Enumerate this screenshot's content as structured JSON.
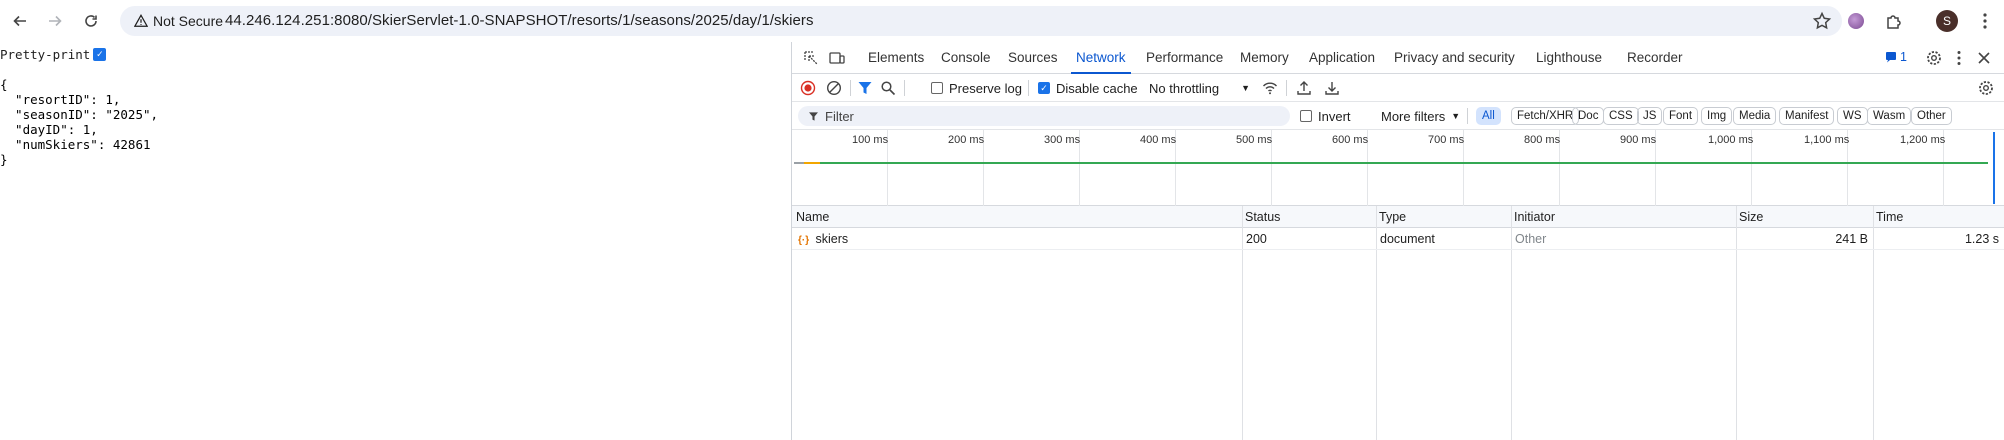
{
  "browser": {
    "security_label": "Not Secure",
    "url": "44.246.124.251:8080/SkierServlet-1.0-SNAPSHOT/resorts/1/seasons/2025/day/1/skiers",
    "profile_initial": "S"
  },
  "page": {
    "pretty_print_label": "Pretty-print",
    "json_text": "{\n  \"resortID\": 1,\n  \"seasonID\": \"2025\",\n  \"dayID\": 1,\n  \"numSkiers\": 42861\n}"
  },
  "devtools": {
    "tabs": [
      "Elements",
      "Console",
      "Sources",
      "Network",
      "Performance",
      "Memory",
      "Application",
      "Privacy and security",
      "Lighthouse",
      "Recorder"
    ],
    "active_tab": "Network",
    "issues_count": "1",
    "toolbar": {
      "preserve_log": "Preserve log",
      "disable_cache": "Disable cache",
      "throttling": "No throttling"
    },
    "filter": {
      "placeholder": "Filter",
      "invert": "Invert",
      "more_filters": "More filters",
      "types": [
        "All",
        "Fetch/XHR",
        "Doc",
        "CSS",
        "JS",
        "Font",
        "Img",
        "Media",
        "Manifest",
        "WS",
        "Wasm",
        "Other"
      ]
    },
    "timeline_ticks": [
      "100 ms",
      "200 ms",
      "300 ms",
      "400 ms",
      "500 ms",
      "600 ms",
      "700 ms",
      "800 ms",
      "900 ms",
      "1,000 ms",
      "1,100 ms",
      "1,200 ms"
    ],
    "columns": [
      "Name",
      "Status",
      "Type",
      "Initiator",
      "Size",
      "Time"
    ],
    "requests": [
      {
        "name": "skiers",
        "status": "200",
        "type": "document",
        "initiator": "Other",
        "size": "241 B",
        "time": "1.23 s"
      }
    ]
  },
  "colors": {
    "accent": "#0b57d0",
    "checkbox": "#1a73e8",
    "waterfall": "#34a853"
  }
}
